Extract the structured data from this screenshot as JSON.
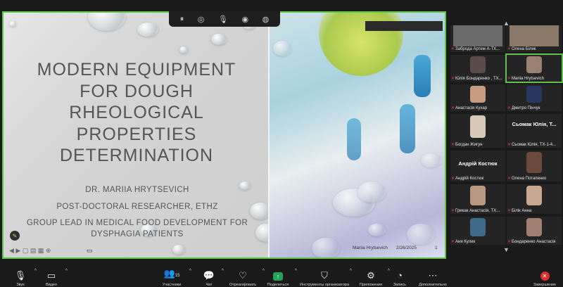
{
  "slide": {
    "title_lines": [
      "MODERN EQUIPMENT",
      "FOR DOUGH",
      "RHEOLOGICAL",
      "PROPERTIES",
      "DETERMINATION"
    ],
    "presenter": "DR. MARIIA HRYTSEVICH",
    "role": "POST-DOCTORAL RESEARCHER, ETHZ",
    "group_line1": "GROUP LEAD IN MEDICAL FOOD DEVELOPMENT FOR",
    "group_line2": "DYSPHAGIA PATIENTS",
    "footer_author": "Mariia Hrytsevich",
    "footer_date": "2/26/2025",
    "footer_page": "1"
  },
  "participants": [
    {
      "name": "Заброда Артем А-ТХ...",
      "muted": true
    },
    {
      "name": "Олена Білик",
      "muted": true
    },
    {
      "name": "Юлія Бондаренко , ТХ...",
      "muted": true
    },
    {
      "name": "Mariia Hrytsevich",
      "muted": true
    },
    {
      "name": "Анастасія Кухар",
      "muted": true
    },
    {
      "name": "Дмитро Пінчук",
      "muted": true
    },
    {
      "name": "Богдан Жигун",
      "muted": true
    },
    {
      "name": "Сьомак Юлія, ТХ-1-4...",
      "muted": true,
      "big_label": "Сьомак Юлія, Т..."
    },
    {
      "name": "Андрій Костюк",
      "muted": true,
      "big_label": "Андрій Костюк"
    },
    {
      "name": "Олена Потапенко",
      "muted": true
    },
    {
      "name": "Грикак Анастасія, ТХ...",
      "muted": true
    },
    {
      "name": "Білік Анна",
      "muted": true
    },
    {
      "name": "Аня Кулик",
      "muted": true
    },
    {
      "name": "Бондаренко Анастасія",
      "muted": true
    }
  ],
  "toolbar": {
    "audio": "Звук",
    "video": "Видео",
    "participants": "Участники",
    "participants_count": "15",
    "chat": "Чат",
    "react": "Отреагировать",
    "share": "Поделиться",
    "host_tools": "Инструменты организатора",
    "apps": "Приложения",
    "record": "Запись",
    "more": "Дополнительно",
    "end": "Завершение"
  },
  "colors": {
    "active_speaker": "#5fc24a",
    "share_button": "#23a35a",
    "end_button": "#d9302c",
    "muted_icon": "#e0453d"
  }
}
